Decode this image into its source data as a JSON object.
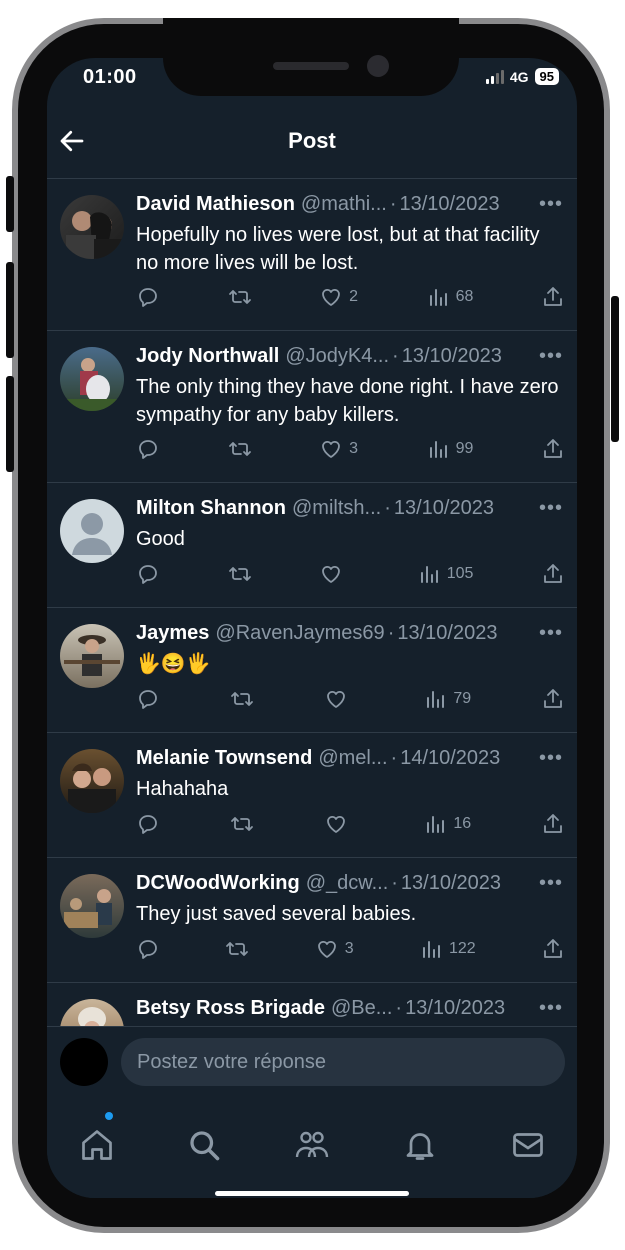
{
  "status_bar": {
    "time": "01:00",
    "network": "4G",
    "battery": "95"
  },
  "header": {
    "title": "Post"
  },
  "tweets": [
    {
      "name": "David Mathieson",
      "handle": "@mathi...",
      "date": "13/10/2023",
      "text": "Hopefully no lives were lost, but at that facility no more lives will be lost.",
      "likes": "2",
      "views": "68"
    },
    {
      "name": "Jody Northwall",
      "handle": "@JodyK4...",
      "date": "13/10/2023",
      "text": "The only thing they have done right. I have zero sympathy for any baby killers.",
      "likes": "3",
      "views": "99"
    },
    {
      "name": "Milton Shannon",
      "handle": "@miltsh...",
      "date": "13/10/2023",
      "text": "Good",
      "likes": "",
      "views": "105"
    },
    {
      "name": "Jaymes",
      "handle": "@RavenJaymes69",
      "date": "13/10/2023",
      "text": "🖐😆🖐",
      "likes": "",
      "views": "79"
    },
    {
      "name": "Melanie Townsend",
      "handle": "@mel...",
      "date": "14/10/2023",
      "text": "Hahahaha",
      "likes": "",
      "views": "16"
    },
    {
      "name": "DCWoodWorking",
      "handle": "@_dcw...",
      "date": "13/10/2023",
      "text": "They just saved several babies.",
      "likes": "3",
      "views": "122"
    },
    {
      "name": "Betsy Ross Brigade",
      "handle": "@Be...",
      "date": "13/10/2023",
      "text": "",
      "likes": "",
      "views": ""
    }
  ],
  "reply": {
    "placeholder": "Postez votre réponse"
  },
  "tabs": [
    {
      "icon": "home-icon"
    },
    {
      "icon": "search-icon"
    },
    {
      "icon": "communities-icon"
    },
    {
      "icon": "bell-icon"
    },
    {
      "icon": "mail-icon"
    }
  ],
  "colors": {
    "background": "#15202b",
    "text": "#ffffff",
    "muted": "#8b98a5",
    "accent": "#1d9bf0",
    "divider": "#2f3b47"
  }
}
